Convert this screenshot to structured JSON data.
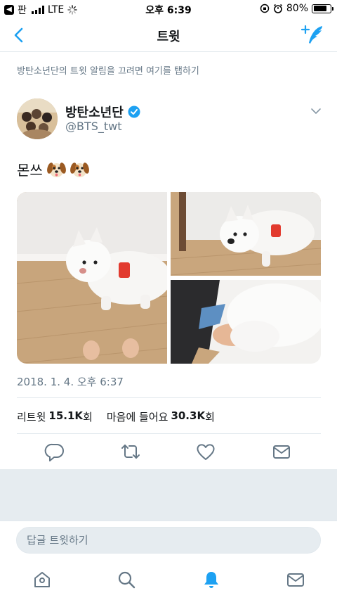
{
  "status_bar": {
    "back_app": "판",
    "network": "LTE",
    "time": "오후 6:39",
    "battery": "80%",
    "battery_level": 0.8
  },
  "nav": {
    "title": "트윗"
  },
  "notification_banner": "방탄소년단의 트윗 알림을 끄려면 여기를 탭하기",
  "tweet": {
    "display_name": "방탄소년단",
    "handle": "@BTS_twt",
    "text": "몬쓰",
    "timestamp": "2018. 1. 4. 오후 6:37",
    "stats": {
      "retweets_label": "리트윗",
      "retweets_count": "15.1K",
      "retweets_unit": "회",
      "likes_label": "마음에 들어요",
      "likes_count": "30.3K",
      "likes_unit": "회"
    }
  },
  "reply": {
    "placeholder": "답글 트윗하기"
  },
  "colors": {
    "accent": "#1da1f2",
    "secondary_text": "#657786",
    "divider": "#e1e8ed",
    "background_gray": "#e6ecf0"
  },
  "icons": {
    "actions": [
      "reply-icon",
      "retweet-icon",
      "like-icon",
      "dm-icon"
    ],
    "tabs": [
      "home-icon",
      "search-icon",
      "notifications-icon",
      "messages-icon"
    ]
  }
}
